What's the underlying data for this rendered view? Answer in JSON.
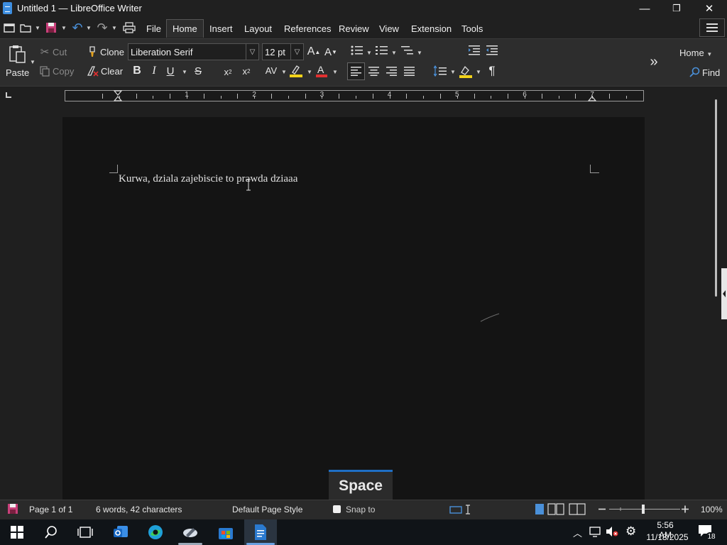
{
  "window": {
    "title": "Untitled 1 — LibreOffice Writer",
    "minimize_glyph": "—",
    "maximize_glyph": "❐",
    "close_glyph": "✕"
  },
  "menu_tabs": [
    {
      "label": "File"
    },
    {
      "label": "Home"
    },
    {
      "label": "Insert"
    },
    {
      "label": "Layout"
    },
    {
      "label": "References"
    },
    {
      "label": "Review"
    },
    {
      "label": "View"
    },
    {
      "label": "Extension"
    },
    {
      "label": "Tools"
    }
  ],
  "active_tab": "Home",
  "ribbon": {
    "paste_label": "Paste",
    "cut_label": "Cut",
    "copy_label": "Copy",
    "clone_label": "Clone",
    "clear_label": "Clear",
    "font_name": "Liberation Serif",
    "font_size": "12 pt",
    "bold_glyph": "B",
    "italic_glyph": "I",
    "underline_glyph": "U",
    "strike_glyph": "S",
    "more_glyph": "»",
    "home_dropdown": "Home",
    "find_label": "Find"
  },
  "ruler": {
    "numbers": [
      "1",
      "2",
      "3",
      "4",
      "5",
      "6",
      "7"
    ]
  },
  "document": {
    "text": "Kurwa, dziala zajebiscie to prawda dziaaa"
  },
  "tooltip": {
    "label": "Space"
  },
  "statusbar": {
    "page": "Page 1 of 1",
    "word_count": "6 words, 42 characters",
    "page_style": "Default Page Style",
    "snap_to": "Snap to",
    "zoom": "100%"
  },
  "taskbar": {
    "time": "5:56 AM",
    "date": "11/18/2025",
    "notification_count": "18"
  },
  "colors": {
    "accent": "#1f6fc5",
    "writer_blue": "#3d8ee0",
    "font_color_red": "#e03030",
    "highlight_yellow": "#f2d21a"
  }
}
